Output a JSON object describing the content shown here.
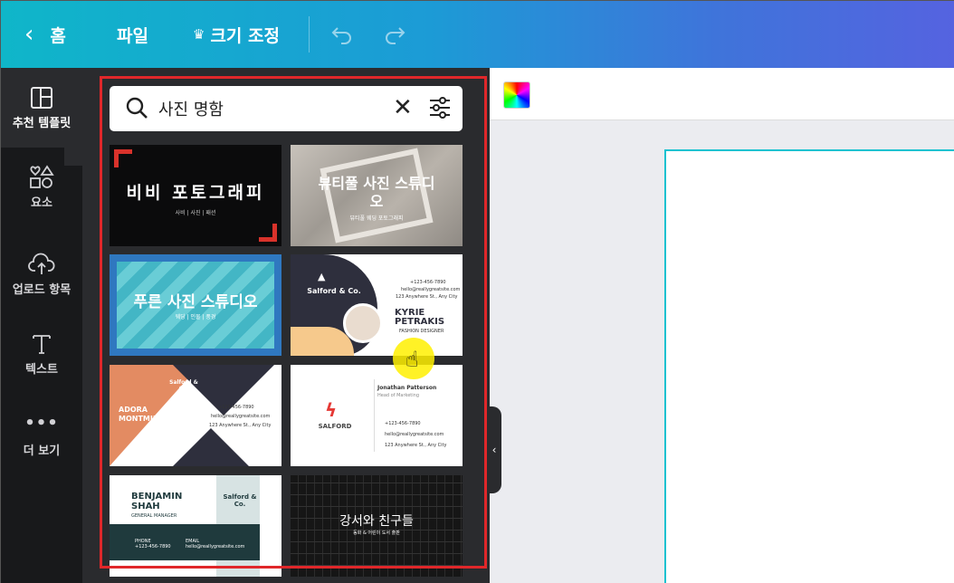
{
  "topbar": {
    "home_label": "홈",
    "file_label": "파일",
    "resize_label": "크기 조정",
    "undo_icon": "undo-icon",
    "redo_icon": "redo-icon"
  },
  "rail": {
    "items": [
      {
        "label": "추천 템플릿",
        "icon": "template-icon"
      },
      {
        "label": "요소",
        "icon": "elements-icon"
      },
      {
        "label": "업로드 항목",
        "icon": "upload-icon"
      },
      {
        "label": "텍스트",
        "icon": "text-icon"
      },
      {
        "label": "더 보기",
        "icon": "more-icon"
      }
    ]
  },
  "search": {
    "value": "사진 명함"
  },
  "templates": [
    {
      "title": "비비 포토그래피",
      "subtitle": "사비 | 사진 | 패션"
    },
    {
      "title": "뷰티풀 사진 스튜디오",
      "subtitle": "뷰티풀 웨딩 포토그래피"
    },
    {
      "title": "푸른 사진 스튜디오",
      "subtitle": "웨딩 | 인물 | 풍경"
    },
    {
      "brand": "Salford & Co.",
      "name": "KYRIE PETRAKIS",
      "role": "FASHION DESIGNER",
      "phone": "+123-456-7890",
      "email": "hello@reallygreatsite.com",
      "address": "123 Anywhere St., Any City"
    },
    {
      "brand": "Salford & Co.",
      "name": "ADORA MONTMINY",
      "phone": "+123-456-7890",
      "email": "hello@reallygreatsite.com",
      "address": "123 Anywhere St., Any City"
    },
    {
      "brand": "SALFORD",
      "name": "Jonathan Patterson",
      "role": "Head of Marketing",
      "phone": "+123-456-7890",
      "email": "hello@reallygreatsite.com",
      "address": "123 Anywhere St., Any City"
    },
    {
      "brand": "Salford & Co.",
      "name": "BENJAMIN SHAH",
      "role": "GENERAL MANAGER",
      "phone": "+123-456-7890",
      "email": "hello@reallygreatsite.com",
      "phone_label": "PHONE",
      "email_label": "EMAIL"
    },
    {
      "title": "강서와 친구들",
      "subtitle": "동화 & 어린이 도서 출판"
    }
  ],
  "colors": {
    "topbar_start": "#0fb6c9",
    "topbar_end": "#5563e0",
    "panel_bg": "#2a2b2e",
    "rail_bg": "#18191b",
    "highlight_frame": "#e0272a",
    "page_border": "#13c2d0"
  }
}
